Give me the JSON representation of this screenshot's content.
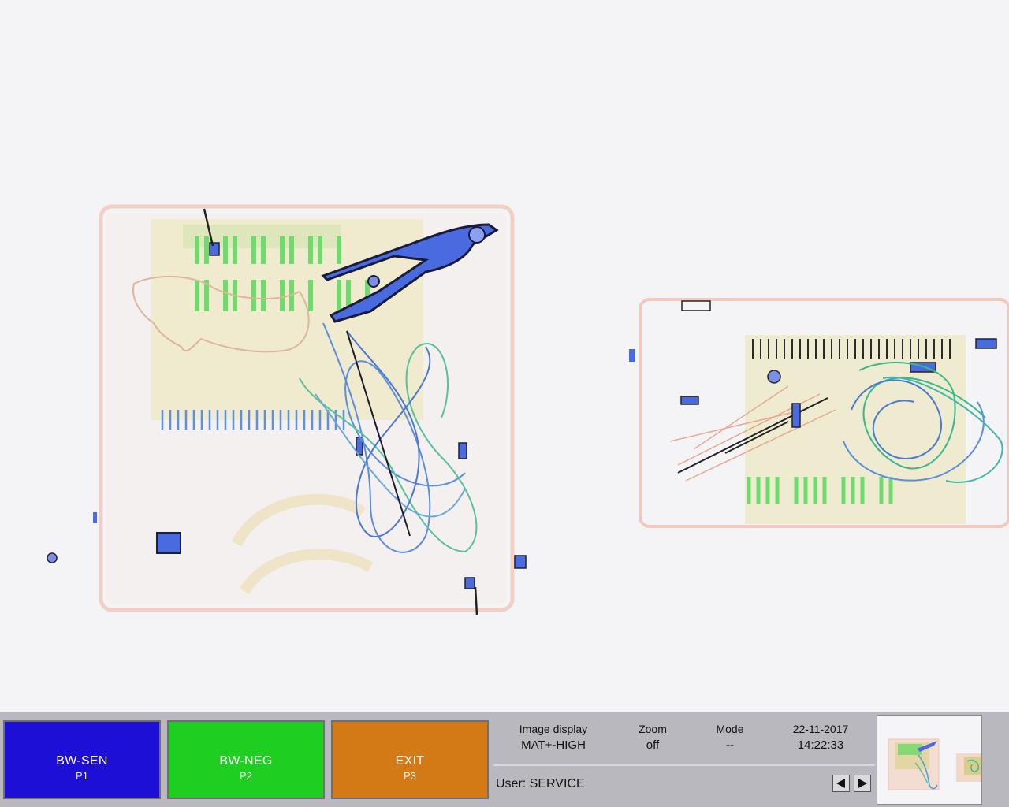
{
  "scan_view": {
    "icon": "xray-scan-image"
  },
  "function_keys": [
    {
      "label": "BW-SEN",
      "key": "P1",
      "color": "#1e0fd6"
    },
    {
      "label": "BW-NEG",
      "key": "P2",
      "color": "#1ecf22"
    },
    {
      "label": "EXIT",
      "key": "P3",
      "color": "#d37a17"
    }
  ],
  "status": {
    "image_display": {
      "label": "Image display",
      "value": "MAT+-HIGH"
    },
    "zoom": {
      "label": "Zoom",
      "value": "off"
    },
    "mode": {
      "label": "Mode",
      "value": "--"
    },
    "datetime": {
      "date": "22-11-2017",
      "time": "14:22:33"
    }
  },
  "user_line": "User: SERVICE",
  "navigation": {
    "prev_icon": "triangle-left-icon",
    "next_icon": "triangle-right-icon"
  },
  "thumbnail": {
    "icon": "scan-thumbnail"
  }
}
